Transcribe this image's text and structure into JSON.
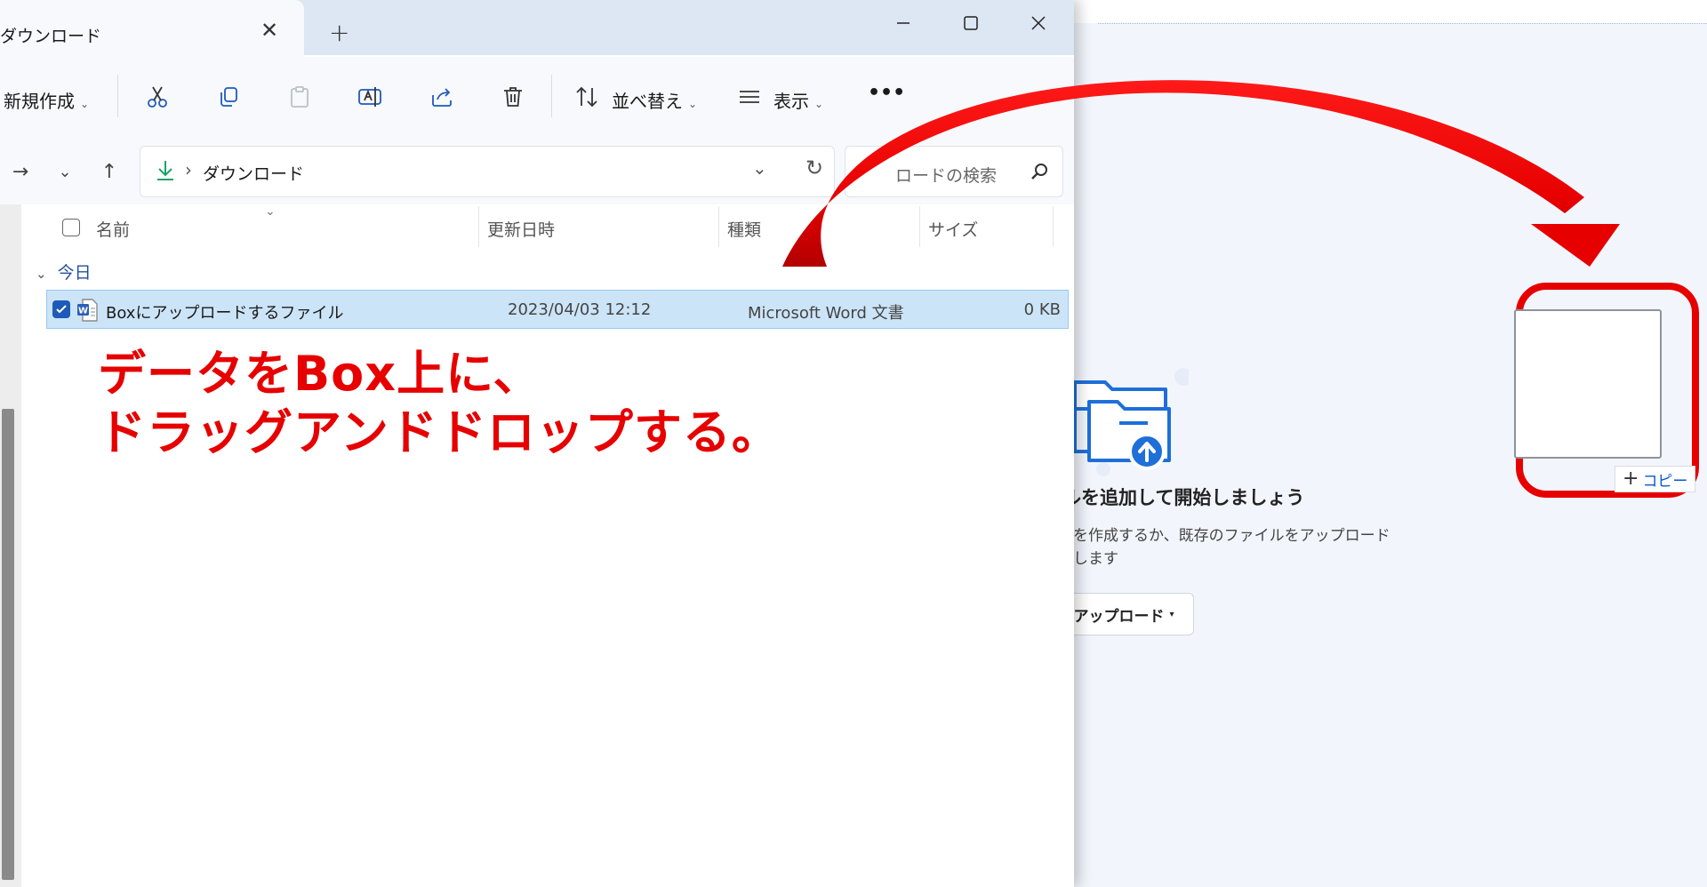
{
  "box": {
    "empty_title": "ルを追加して開始しましょう",
    "empty_desc": "を作成するか、既存のファイルをアップロードします",
    "upload_button": "アップロード",
    "copy_chip": "コピー"
  },
  "explorer": {
    "tab_title": "ダウンロード",
    "toolbar": {
      "new_label": "新規作成",
      "sort_label": "並べ替え",
      "view_label": "表示",
      "more_label": "•••"
    },
    "address": {
      "path": "ダウンロード"
    },
    "search": {
      "placeholder": "ロードの検索"
    },
    "columns": {
      "name": "名前",
      "modified": "更新日時",
      "type": "種類",
      "size": "サイズ"
    },
    "group_label": "今日",
    "files": [
      {
        "name": "Boxにアップロードするファイル",
        "modified": "2023/04/03 12:12",
        "type": "Microsoft Word 文書",
        "size": "0 KB"
      }
    ]
  },
  "annotation": {
    "line1": "データをBox上に、",
    "line2": "ドラッグアンドドロップする。"
  },
  "colors": {
    "annotation": "#e60000",
    "selection": "#cce4f7",
    "accent": "#1e5bb8"
  }
}
